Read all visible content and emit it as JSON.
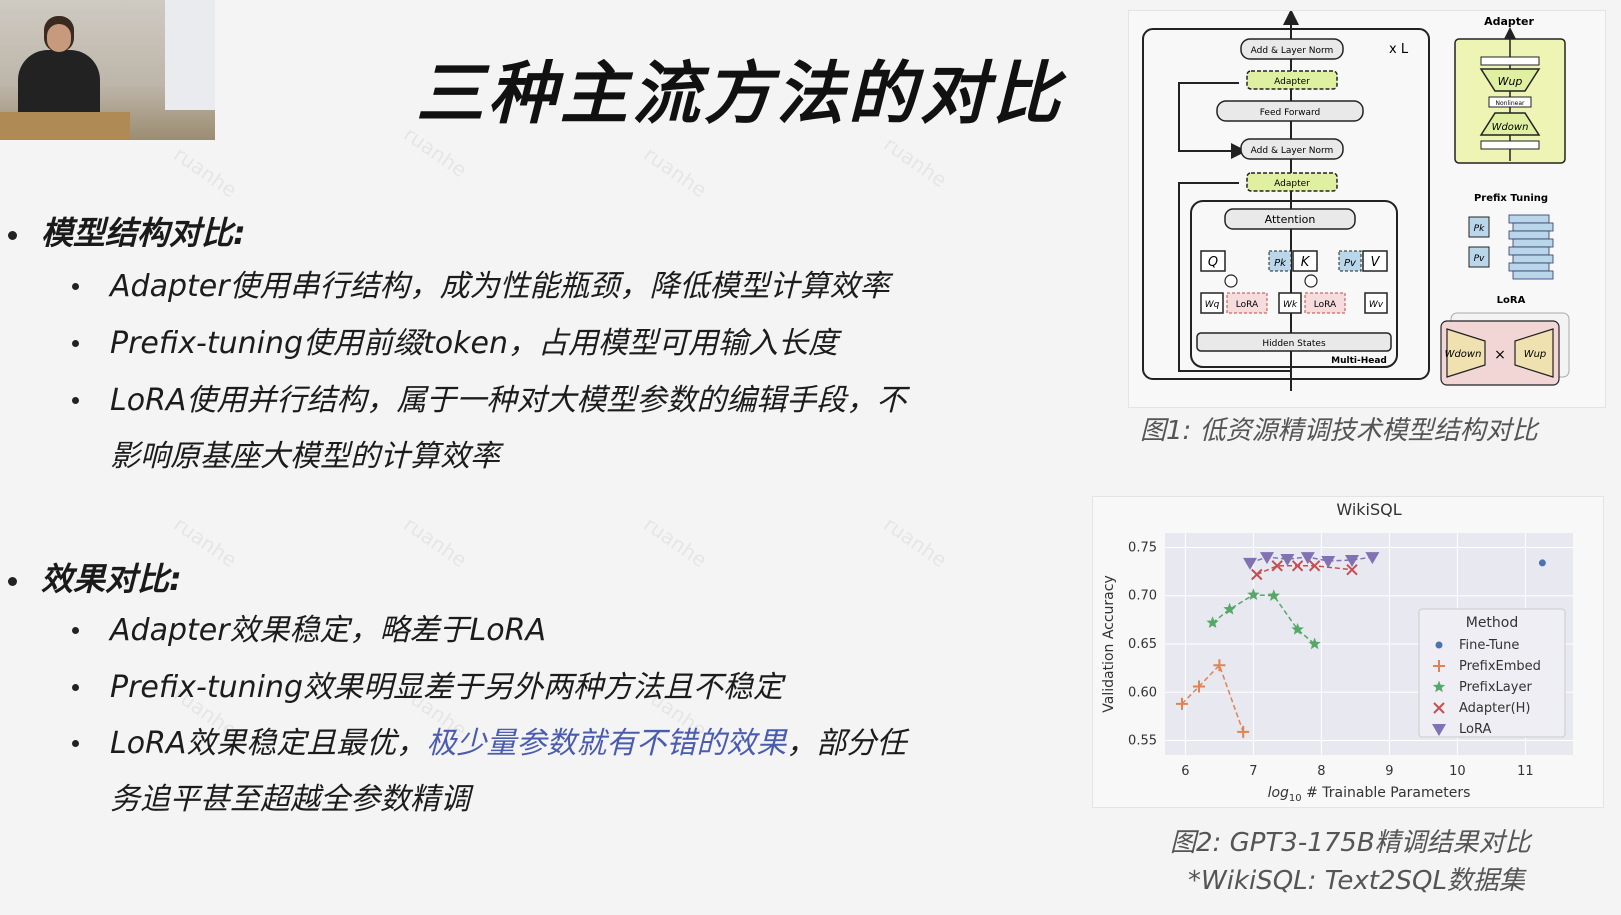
{
  "slide": {
    "title": "三种主流方法的对比",
    "section1": {
      "heading": "模型结构对比:",
      "items": [
        "Adapter使用串行结构，成为性能瓶颈，降低模型计算效率",
        "Prefix-tuning使用前缀token，占用模型可用输入长度",
        "LoRA使用并行结构，属于一种对大模型参数的编辑手段，不",
        "影响原基座大模型的计算效率"
      ]
    },
    "section2": {
      "heading": "效果对比:",
      "items": [
        "Adapter效果稳定，略差于LoRA",
        "Prefix-tuning效果明显差于另外两种方法且不稳定"
      ],
      "item3_pre": "LoRA效果稳定且最优，",
      "item3_highlight": "极少量参数就有不错的效果",
      "item3_post": "，部分任",
      "item3_cont": "务追平甚至超越全参数精调"
    },
    "watermark": "ruanhe",
    "fig1_caption": "图1: 低资源精调技术模型结构对比",
    "fig2_caption": "图2: GPT3-175B精调结果对比",
    "fig2_note": "*WikiSQL: Text2SQL数据集",
    "accent_color": "#4a5cb0"
  },
  "diagram": {
    "xl": "x L",
    "add_norm_top": "Add & Layer Norm",
    "adapter_top": "Adapter",
    "feed_forward": "Feed Forward",
    "add_norm_mid": "Add & Layer Norm",
    "adapter_mid": "Adapter",
    "attention": "Attention",
    "hidden_states": "Hidden States",
    "multi_head": "Multi-Head",
    "q": "Q",
    "k": "K",
    "v": "V",
    "pk": "Pk",
    "pv": "Pv",
    "wq": "Wq",
    "wk": "Wk",
    "wv": "Wv",
    "lora1": "LoRA",
    "lora2": "LoRA",
    "side_adapter": "Adapter",
    "w_up": "Wup",
    "nonlinear": "Nonlinear",
    "w_down": "Wdown",
    "prefix_tuning": "Prefix Tuning",
    "pk2": "Pk",
    "pv2": "Pv",
    "side_lora": "LoRA",
    "lora_wdown": "Wdown",
    "lora_times": "×",
    "lora_wup": "Wup"
  },
  "chart_data": {
    "type": "scatter",
    "title": "WikiSQL",
    "xlabel_pre": "log",
    "xlabel_sub": "10",
    "xlabel_post": " # Trainable Parameters",
    "ylabel": "Validation Accuracy",
    "xlim": [
      5.7,
      11.7
    ],
    "ylim": [
      0.535,
      0.765
    ],
    "xticks": [
      6,
      7,
      8,
      9,
      10,
      11
    ],
    "yticks": [
      0.55,
      0.6,
      0.65,
      0.7,
      0.75
    ],
    "grid": true,
    "legend_title": "Method",
    "legend_position": "lower-right",
    "series": [
      {
        "name": "Fine-Tune",
        "marker": "dot",
        "color": "#4c72b0",
        "points": [
          [
            11.25,
            0.734
          ]
        ]
      },
      {
        "name": "PrefixEmbed",
        "marker": "plus",
        "color": "#dd8452",
        "points": [
          [
            5.95,
            0.588
          ],
          [
            6.2,
            0.606
          ],
          [
            6.5,
            0.628
          ],
          [
            6.85,
            0.559
          ]
        ]
      },
      {
        "name": "PrefixLayer",
        "marker": "star",
        "color": "#55a868",
        "points": [
          [
            6.4,
            0.672
          ],
          [
            6.65,
            0.686
          ],
          [
            7.0,
            0.701
          ],
          [
            7.3,
            0.7
          ],
          [
            7.65,
            0.665
          ],
          [
            7.9,
            0.65
          ]
        ]
      },
      {
        "name": "Adapter(H)",
        "marker": "x",
        "color": "#c44e52",
        "points": [
          [
            7.05,
            0.722
          ],
          [
            7.35,
            0.731
          ],
          [
            7.65,
            0.731
          ],
          [
            7.9,
            0.731
          ],
          [
            8.45,
            0.727
          ]
        ]
      },
      {
        "name": "LoRA",
        "marker": "tri",
        "color": "#8172b2",
        "points": [
          [
            6.95,
            0.734
          ],
          [
            7.2,
            0.74
          ],
          [
            7.5,
            0.738
          ],
          [
            7.8,
            0.74
          ],
          [
            8.1,
            0.736
          ],
          [
            8.45,
            0.737
          ],
          [
            8.75,
            0.74
          ]
        ]
      }
    ]
  }
}
